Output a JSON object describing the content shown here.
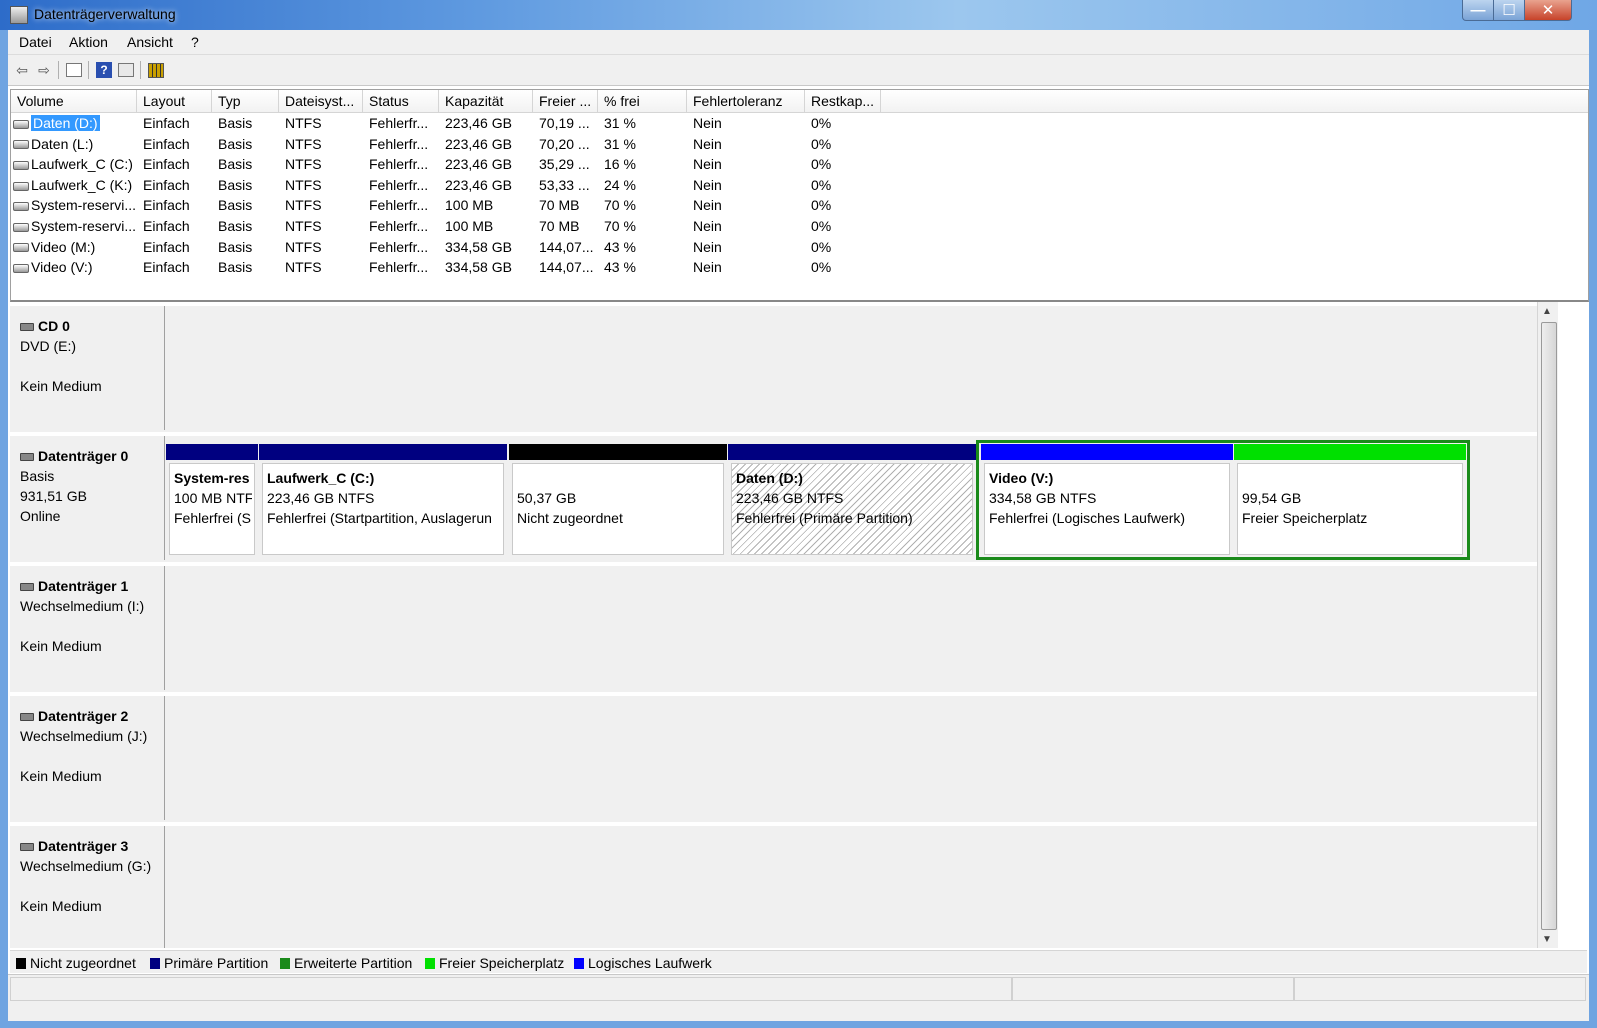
{
  "window": {
    "title": "Datenträgerverwaltung",
    "min": "—",
    "max": "☐",
    "close": "✕"
  },
  "menu": [
    {
      "label": "Datei"
    },
    {
      "label": "Aktion"
    },
    {
      "label": "Ansicht"
    },
    {
      "label": "?"
    }
  ],
  "toolbar": {
    "back_icon": "back-arrow-icon",
    "forward_icon": "forward-arrow-icon",
    "console_tree_icon": "console-tree-icon",
    "help_icon": "help-icon",
    "properties_icon": "properties-icon",
    "settings_icon": "disk-settings-icon"
  },
  "columns": [
    "Volume",
    "Layout",
    "Typ",
    "Dateisyst...",
    "Status",
    "Kapazität",
    "Freier ...",
    "% frei",
    "Fehlertoleranz",
    "Restkap..."
  ],
  "volumes": [
    {
      "name": "Daten (D:)",
      "layout": "Einfach",
      "typ": "Basis",
      "fs": "NTFS",
      "status": "Fehlerfr...",
      "cap": "223,46 GB",
      "free": "70,19 ...",
      "pct": "31 %",
      "ft": "Nein",
      "rest": "0%"
    },
    {
      "name": "Daten (L:)",
      "layout": "Einfach",
      "typ": "Basis",
      "fs": "NTFS",
      "status": "Fehlerfr...",
      "cap": "223,46 GB",
      "free": "70,20 ...",
      "pct": "31 %",
      "ft": "Nein",
      "rest": "0%"
    },
    {
      "name": "Laufwerk_C (C:)",
      "layout": "Einfach",
      "typ": "Basis",
      "fs": "NTFS",
      "status": "Fehlerfr...",
      "cap": "223,46 GB",
      "free": "35,29 ...",
      "pct": "16 %",
      "ft": "Nein",
      "rest": "0%"
    },
    {
      "name": "Laufwerk_C (K:)",
      "layout": "Einfach",
      "typ": "Basis",
      "fs": "NTFS",
      "status": "Fehlerfr...",
      "cap": "223,46 GB",
      "free": "53,33 ...",
      "pct": "24 %",
      "ft": "Nein",
      "rest": "0%"
    },
    {
      "name": "System-reservi...",
      "layout": "Einfach",
      "typ": "Basis",
      "fs": "NTFS",
      "status": "Fehlerfr...",
      "cap": "100 MB",
      "free": "70 MB",
      "pct": "70 %",
      "ft": "Nein",
      "rest": "0%"
    },
    {
      "name": "System-reservi...",
      "layout": "Einfach",
      "typ": "Basis",
      "fs": "NTFS",
      "status": "Fehlerfr...",
      "cap": "100 MB",
      "free": "70 MB",
      "pct": "70 %",
      "ft": "Nein",
      "rest": "0%"
    },
    {
      "name": "Video (M:)",
      "layout": "Einfach",
      "typ": "Basis",
      "fs": "NTFS",
      "status": "Fehlerfr...",
      "cap": "334,58 GB",
      "free": "144,07...",
      "pct": "43 %",
      "ft": "Nein",
      "rest": "0%"
    },
    {
      "name": "Video (V:)",
      "layout": "Einfach",
      "typ": "Basis",
      "fs": "NTFS",
      "status": "Fehlerfr...",
      "cap": "334,58 GB",
      "free": "144,07...",
      "pct": "43 %",
      "ft": "Nein",
      "rest": "0%"
    }
  ],
  "disks": [
    {
      "name": "CD 0",
      "line1": "DVD (E:)",
      "line2": "",
      "line3": "Kein Medium"
    },
    {
      "name": "Datenträger 0",
      "line1": "Basis",
      "line2": "931,51 GB",
      "line3": "Online"
    },
    {
      "name": "Datenträger 1",
      "line1": "Wechselmedium (I:)",
      "line2": "",
      "line3": "Kein Medium"
    },
    {
      "name": "Datenträger 2",
      "line1": "Wechselmedium (J:)",
      "line2": "",
      "line3": "Kein Medium"
    },
    {
      "name": "Datenträger 3",
      "line1": "Wechselmedium (G:)",
      "line2": "",
      "line3": "Kein Medium"
    }
  ],
  "partitions": [
    {
      "title": "System-res",
      "size": "100 MB NTF",
      "status": "Fehlerfrei (S",
      "color": "#000080"
    },
    {
      "title": "Laufwerk_C  (C:)",
      "size": "223,46 GB NTFS",
      "status": "Fehlerfrei (Startpartition, Auslagerun",
      "color": "#000080"
    },
    {
      "title": "",
      "size": "50,37 GB",
      "status": "Nicht zugeordnet",
      "color": "#000000"
    },
    {
      "title": "Daten  (D:)",
      "size": "223,46 GB NTFS",
      "status": "Fehlerfrei (Primäre Partition)",
      "color": "#000080"
    },
    {
      "title": "Video  (V:)",
      "size": "334,58 GB NTFS",
      "status": "Fehlerfrei (Logisches Laufwerk)",
      "color": "#0000ff"
    },
    {
      "title": "",
      "size": "99,54 GB",
      "status": "Freier Speicherplatz",
      "color": "#00e000"
    }
  ],
  "legend": [
    {
      "label": "Nicht zugeordnet",
      "color": "#000000"
    },
    {
      "label": "Primäre Partition",
      "color": "#000080"
    },
    {
      "label": "Erweiterte Partition",
      "color": "#1a8a1a"
    },
    {
      "label": "Freier Speicherplatz",
      "color": "#00e000"
    },
    {
      "label": "Logisches Laufwerk",
      "color": "#0000ff"
    }
  ]
}
